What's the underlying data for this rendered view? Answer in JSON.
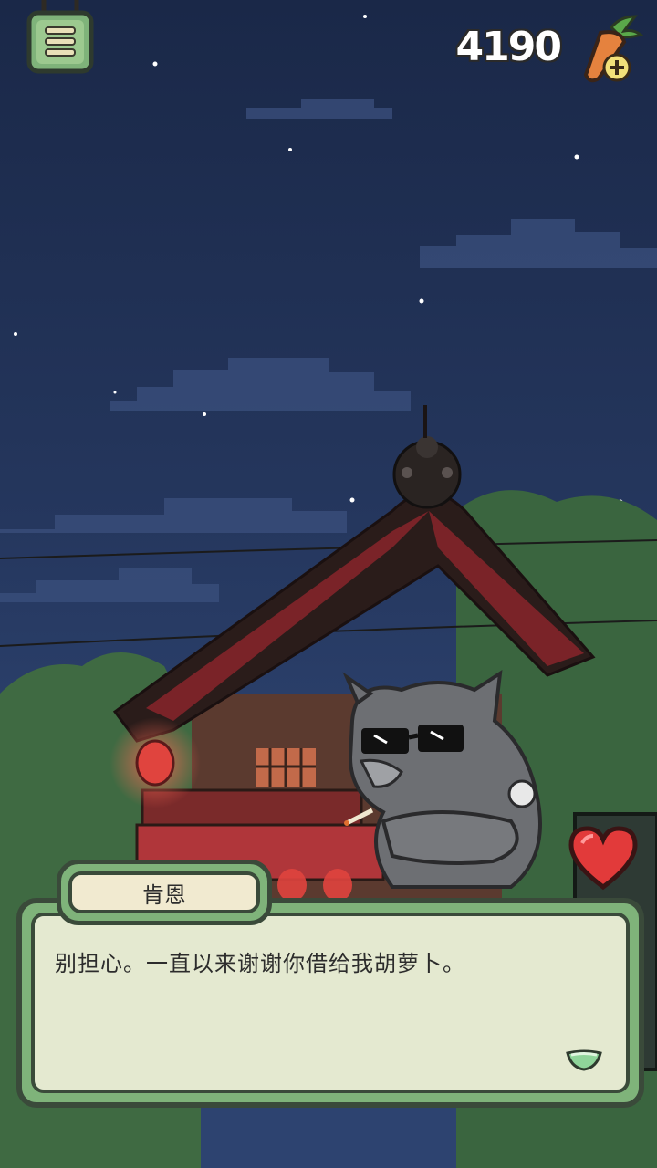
{
  "hud": {
    "carrot_count": "4190",
    "menu_icon": "ladder-menu-icon",
    "carrot_icon": "carrot-plus-icon"
  },
  "dialog": {
    "speaker_name": "肯恩",
    "message": "别担心。一直以来谢谢你借给我胡萝卜。",
    "next_icon": "next-arrow-icon"
  },
  "colors": {
    "sky": "#1f2f52",
    "panel_green": "#7fb37a",
    "panel_paper": "#f3f0dc",
    "heart_red": "#e23a3a",
    "roof_red": "#7a2328"
  }
}
